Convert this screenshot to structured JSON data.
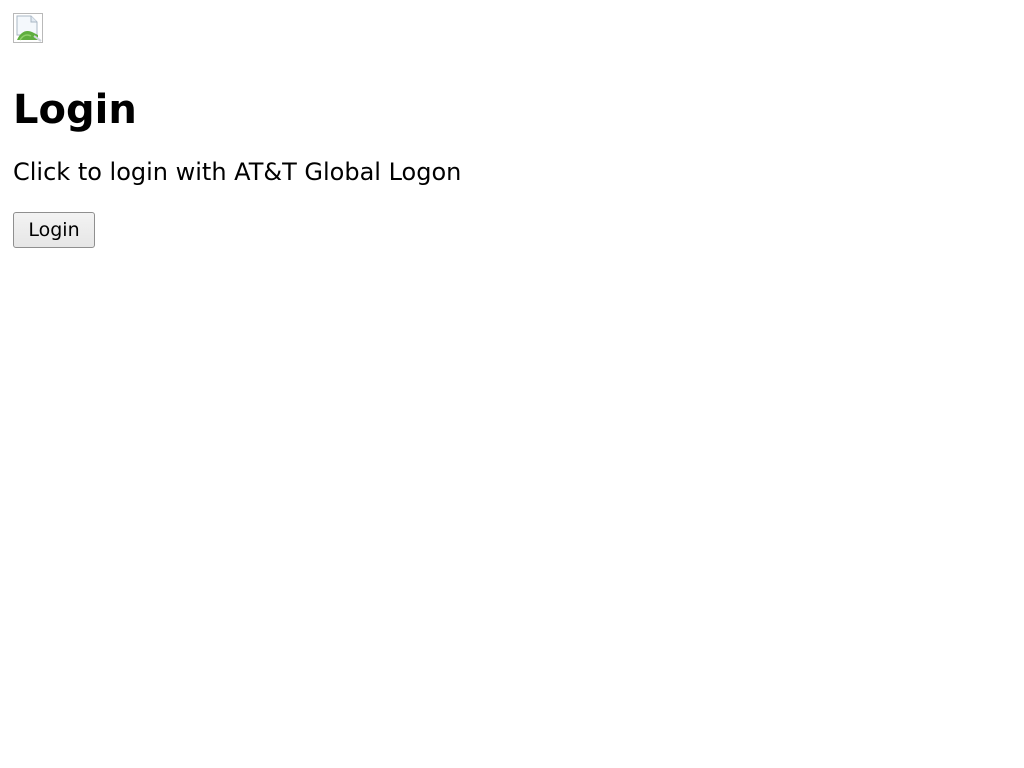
{
  "logo": {
    "icon": "broken-image-icon"
  },
  "heading": "Login",
  "instruction": "Click to login with AT&T Global Logon",
  "login_button": {
    "label": "Login"
  }
}
